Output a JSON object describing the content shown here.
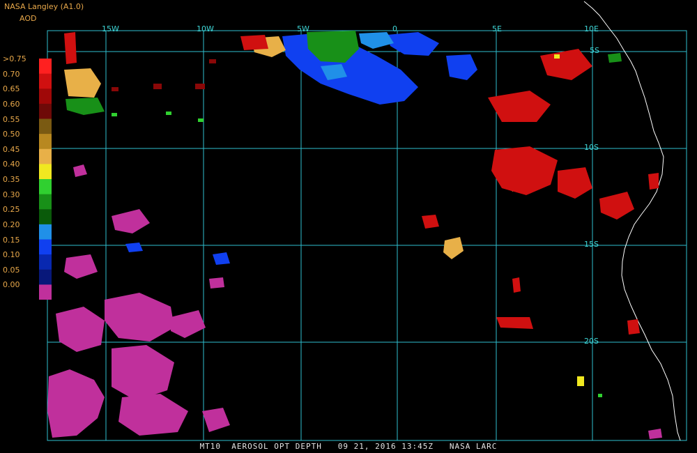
{
  "header": {
    "source": "NASA Langley (A1.0)",
    "product": "AOD"
  },
  "legend": {
    "labels": [
      ">0.75",
      "0.70",
      "0.65",
      "0.60",
      "0.55",
      "0.50",
      "0.45",
      "0.40",
      "0.35",
      "0.30",
      "0.25",
      "0.20",
      "0.15",
      "0.10",
      "0.05",
      "0.00"
    ],
    "colors": [
      "#ff2020",
      "#d01010",
      "#a00808",
      "#6e0a08",
      "#7a5a12",
      "#b88820",
      "#e8b048",
      "#f0e820",
      "#30d030",
      "#189018",
      "#0a5a0a",
      "#2090e8",
      "#1040f0",
      "#0828b0",
      "#08187a",
      "#c0309c"
    ]
  },
  "grid": {
    "lon_labels": [
      "15W",
      "10W",
      "5W",
      "0",
      "5E",
      "10E"
    ],
    "lat_labels": [
      "5S",
      "10S",
      "15S",
      "20S"
    ],
    "line_color": "#2fbfcf"
  },
  "footer": {
    "text": "MT10  AEROSOL OPT DEPTH   09 21, 2016 13:45Z   NASA LARC"
  }
}
